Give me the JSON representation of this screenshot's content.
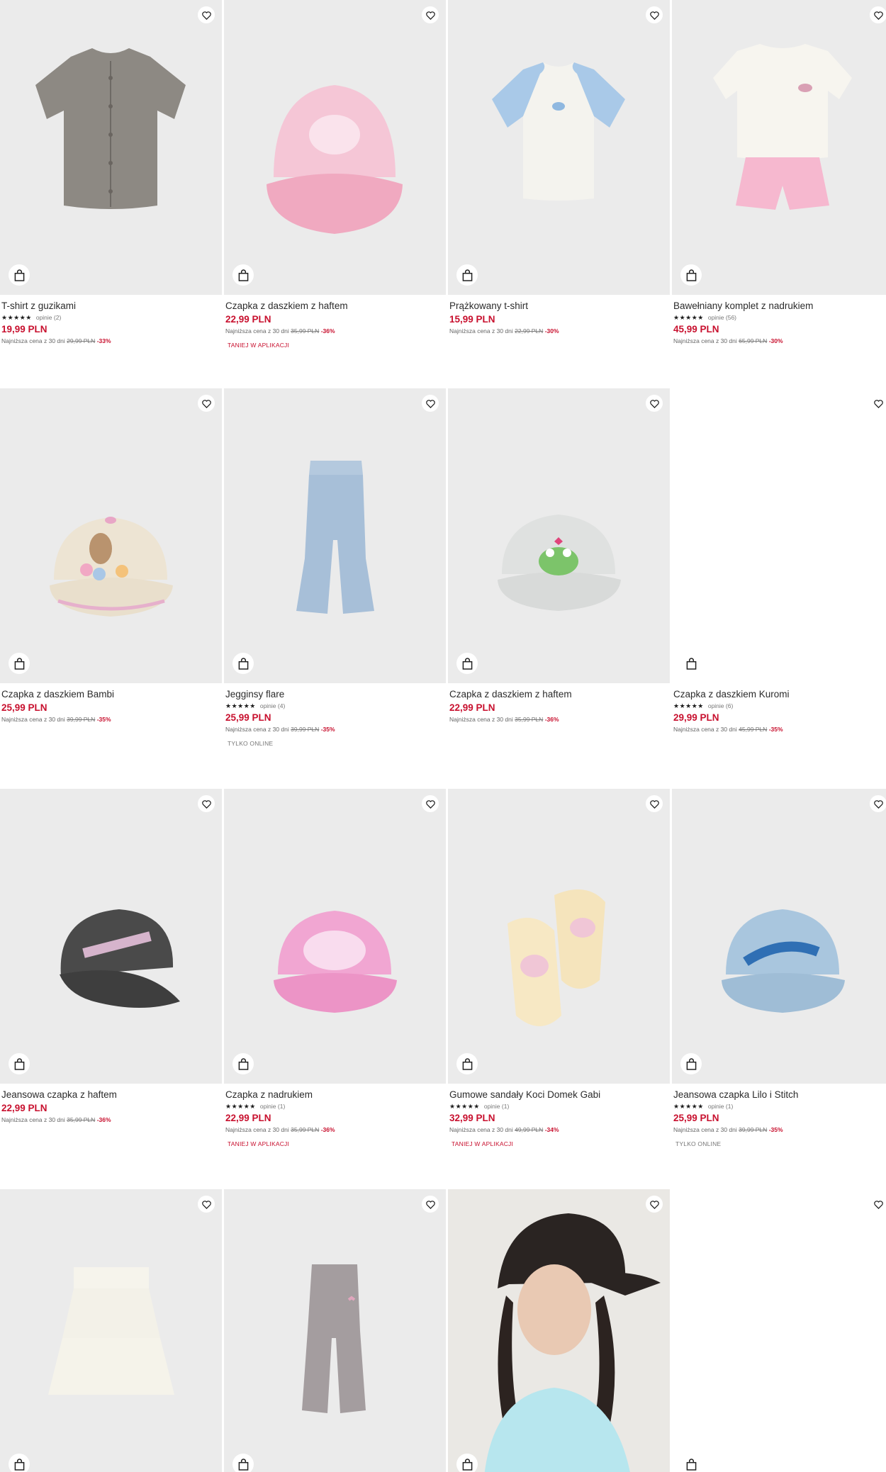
{
  "products": [
    {
      "name": "T-shirt z guzikami",
      "stars": "★★★★★",
      "opinie": "opinie (2)",
      "price": "19,99 PLN",
      "lowest_label": "Najniższa cena z 30 dni",
      "old_price": "29,99 PLN",
      "discount": "-33%",
      "tag": "",
      "image_icon": "ribbed-tshirt-grey"
    },
    {
      "name": "Czapka z daszkiem z haftem",
      "stars": "",
      "opinie": "",
      "price": "22,99 PLN",
      "lowest_label": "Najniższa cena z 30 dni",
      "old_price": "35,99 PLN",
      "discount": "-36%",
      "tag": "TANIEJ W APLIKACJI",
      "image_icon": "pink-cap"
    },
    {
      "name": "Prążkowany t-shirt",
      "stars": "",
      "opinie": "",
      "price": "15,99 PLN",
      "lowest_label": "Najniższa cena z 30 dni",
      "old_price": "22,99 PLN",
      "discount": "-30%",
      "tag": "",
      "image_icon": "white-blue-raglan-tshirt"
    },
    {
      "name": "Bawełniany komplet z nadrukiem",
      "stars": "★★★★★",
      "opinie": "opinie (56)",
      "price": "45,99 PLN",
      "lowest_label": "Najniższa cena z 30 dni",
      "old_price": "65,99 PLN",
      "discount": "-30%",
      "tag": "",
      "image_icon": "tshirt-shorts-set"
    },
    {
      "name": "Czapka z daszkiem Bambi",
      "stars": "",
      "opinie": "",
      "price": "25,99 PLN",
      "lowest_label": "Najniższa cena z 30 dni",
      "old_price": "39,99 PLN",
      "discount": "-35%",
      "tag": "",
      "image_icon": "beige-bunny-cap"
    },
    {
      "name": "Jegginsy flare",
      "stars": "★★★★★",
      "opinie": "opinie (4)",
      "price": "25,99 PLN",
      "lowest_label": "Najniższa cena z 30 dni",
      "old_price": "39,99 PLN",
      "discount": "-35%",
      "tag": "TYLKO ONLINE",
      "image_icon": "flare-jeans"
    },
    {
      "name": "Czapka z daszkiem z haftem",
      "stars": "",
      "opinie": "",
      "price": "22,99 PLN",
      "lowest_label": "Najniższa cena z 30 dni",
      "old_price": "35,99 PLN",
      "discount": "-36%",
      "tag": "",
      "image_icon": "grey-frog-cap"
    },
    {
      "name": "Czapka z daszkiem Kuromi",
      "stars": "★★★★★",
      "opinie": "opinie (6)",
      "price": "29,99 PLN",
      "lowest_label": "Najniższa cena z 30 dni",
      "old_price": "45,99 PLN",
      "discount": "-35%",
      "tag": "",
      "image_icon": "blank"
    },
    {
      "name": "Jeansowa czapka z haftem",
      "stars": "",
      "opinie": "",
      "price": "22,99 PLN",
      "lowest_label": "Najniższa cena z 30 dni",
      "old_price": "35,99 PLN",
      "discount": "-36%",
      "tag": "",
      "image_icon": "black-authentic-cap"
    },
    {
      "name": "Czapka z nadrukiem",
      "stars": "★★★★★",
      "opinie": "opinie (1)",
      "price": "22,99 PLN",
      "lowest_label": "Najniższa cena z 30 dni",
      "old_price": "35,99 PLN",
      "discount": "-36%",
      "tag": "TANIEJ W APLIKACJI",
      "image_icon": "pink-print-cap"
    },
    {
      "name": "Gumowe sandały Koci Domek Gabi",
      "stars": "★★★★★",
      "opinie": "opinie (1)",
      "price": "32,99 PLN",
      "lowest_label": "Najniższa cena z 30 dni",
      "old_price": "49,99 PLN",
      "discount": "-34%",
      "tag": "TANIEJ W APLIKACJI",
      "image_icon": "rubber-sandals"
    },
    {
      "name": "Jeansowa czapka Lilo i Stitch",
      "stars": "★★★★★",
      "opinie": "opinie (1)",
      "price": "25,99 PLN",
      "lowest_label": "Najniższa cena z 30 dni",
      "old_price": "39,99 PLN",
      "discount": "-35%",
      "tag": "TYLKO ONLINE",
      "image_icon": "blue-stitch-cap"
    },
    {
      "name": "",
      "stars": "",
      "opinie": "",
      "price": "",
      "lowest_label": "",
      "old_price": "",
      "discount": "",
      "tag": "",
      "image_icon": "white-tiered-skirt"
    },
    {
      "name": "",
      "stars": "",
      "opinie": "",
      "price": "",
      "lowest_label": "",
      "old_price": "",
      "discount": "",
      "tag": "",
      "image_icon": "corduroy-trousers"
    },
    {
      "name": "",
      "stars": "",
      "opinie": "",
      "price": "",
      "lowest_label": "",
      "old_price": "",
      "discount": "",
      "tag": "",
      "image_icon": "girl-in-black-cap"
    },
    {
      "name": "",
      "stars": "",
      "opinie": "",
      "price": "",
      "lowest_label": "",
      "old_price": "",
      "discount": "",
      "tag": "",
      "image_icon": "blank"
    }
  ],
  "icons": {
    "wishlist": "heart-icon",
    "add_to_cart": "shopping-bag-icon"
  },
  "colors": {
    "price": "#c8102e",
    "tile_bg": "#ebebeb",
    "text": "#2b2b2b"
  }
}
